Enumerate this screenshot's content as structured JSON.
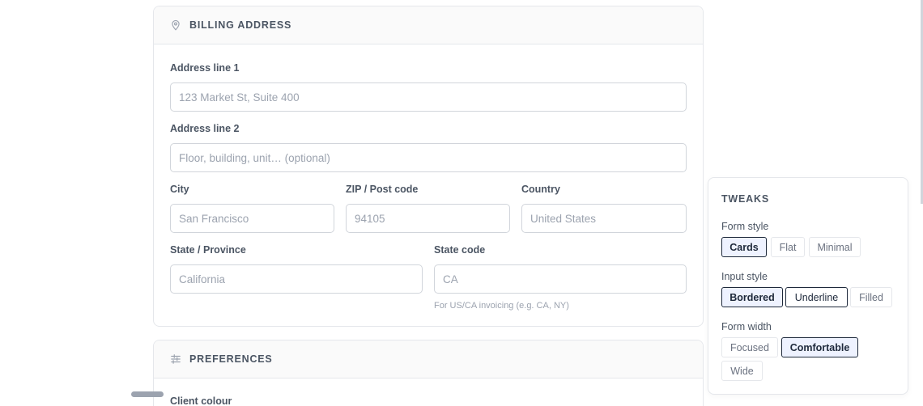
{
  "billing": {
    "title": "BILLING ADDRESS",
    "address1": {
      "label": "Address line 1",
      "placeholder": "123 Market St, Suite 400"
    },
    "address2": {
      "label": "Address line 2",
      "placeholder": "Floor, building, unit… (optional)"
    },
    "city": {
      "label": "City",
      "placeholder": "San Francisco"
    },
    "zip": {
      "label": "ZIP / Post code",
      "placeholder": "94105"
    },
    "country": {
      "label": "Country",
      "placeholder": "United States"
    },
    "state": {
      "label": "State / Province",
      "placeholder": "California"
    },
    "state_code": {
      "label": "State code",
      "placeholder": "CA",
      "hint": "For US/CA invoicing (e.g. CA, NY)"
    }
  },
  "preferences": {
    "title": "PREFERENCES",
    "client_colour_label": "Client colour"
  },
  "tweaks": {
    "title": "TWEAKS",
    "form_style": {
      "label": "Form style",
      "options": [
        "Cards",
        "Flat",
        "Minimal"
      ],
      "selected": "Cards"
    },
    "input_style": {
      "label": "Input style",
      "options": [
        "Bordered",
        "Underline",
        "Filled"
      ],
      "selected": "Bordered"
    },
    "form_width": {
      "label": "Form width",
      "options": [
        "Focused",
        "Comfortable",
        "Wide"
      ],
      "selected": "Comfortable"
    }
  },
  "icons": {
    "billing": "map-pin-icon",
    "preferences": "sliders-icon"
  },
  "colors": {
    "accent": "#1e293b",
    "accent_bg": "#eef2ff",
    "border": "#e5e7eb"
  }
}
